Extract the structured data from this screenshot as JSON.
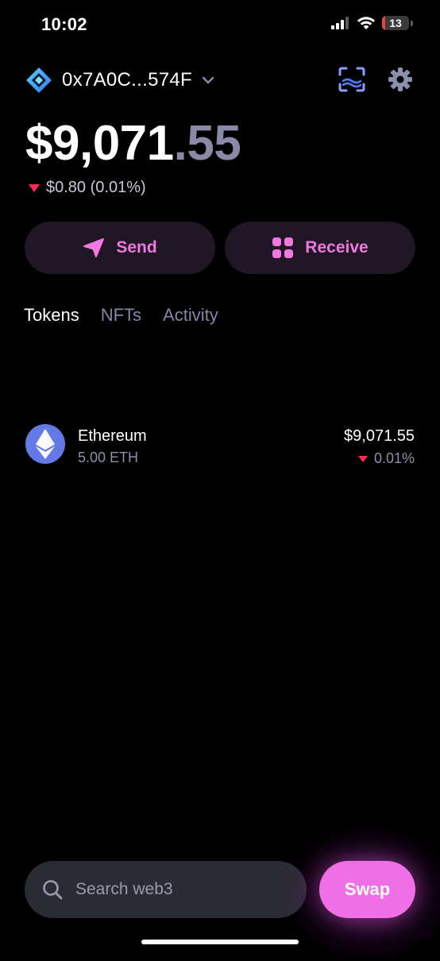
{
  "status_bar": {
    "time": "10:02",
    "battery_level": "13",
    "battery_fraction": 0.13
  },
  "account": {
    "address": "0x7A0C...574F",
    "logo_icon": "wallet-logo-icon",
    "dropdown_icon": "chevron-down-icon",
    "scan_icon": "scan-qr-icon",
    "settings_icon": "gear-icon"
  },
  "balance": {
    "whole": "$9,071",
    "decimal": ".55",
    "change_text": "$0.80 (0.01%)",
    "change_direction_icon": "triangle-down-icon"
  },
  "actions": {
    "send_label": "Send",
    "receive_label": "Receive"
  },
  "tabs": [
    {
      "label": "Tokens",
      "active": true
    },
    {
      "label": "NFTs",
      "active": false
    },
    {
      "label": "Activity",
      "active": false
    }
  ],
  "tokens": [
    {
      "name": "Ethereum",
      "amount": "5.00 ETH",
      "value": "$9,071.55",
      "change": "0.01%",
      "icon": "ethereum-icon"
    }
  ],
  "bottom_bar": {
    "search_placeholder": "Search web3",
    "swap_label": "Swap"
  },
  "colors": {
    "background": "#000000",
    "accent_pink": "#f178e0",
    "swap_pink": "#f06ee6",
    "muted_text": "#8a90ab",
    "negative_red": "#ff2d55",
    "button_bg": "#211626"
  }
}
